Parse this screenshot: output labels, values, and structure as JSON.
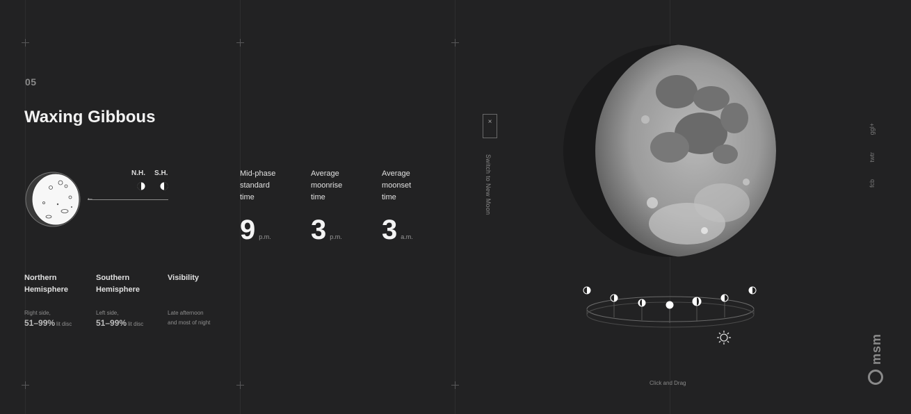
{
  "phase": {
    "number": "05",
    "title": "Waxing Gibbous"
  },
  "hemispheres": {
    "nh_label": "N.H.",
    "sh_label": "S.H."
  },
  "times": [
    {
      "label_lines": [
        "Mid-phase",
        "standard",
        "time"
      ],
      "value": "9",
      "unit": "p.m."
    },
    {
      "label_lines": [
        "Average",
        "moonrise",
        "time"
      ],
      "value": "3",
      "unit": "p.m."
    },
    {
      "label_lines": [
        "Average",
        "moonset",
        "time"
      ],
      "value": "3",
      "unit": "a.m."
    }
  ],
  "info": [
    {
      "title_lines": [
        "Northern",
        "Hemisphere"
      ],
      "desc_small": "Right side,",
      "desc_big": "51–99%",
      "desc_suffix": "lit disc"
    },
    {
      "title_lines": [
        "Southern",
        "Hemisphere"
      ],
      "desc_small": "Left side,",
      "desc_big": "51–99%",
      "desc_suffix": "lit disc"
    },
    {
      "title_lines": [
        "Visibility"
      ],
      "desc_small": "Late afternoon",
      "desc_line2": "and most of night"
    }
  ],
  "switch": {
    "close_symbol": "×",
    "label": "Switch to New Moon"
  },
  "orbit_hint": "Click and Drag",
  "social": [
    "ggl+",
    "twtr",
    "fcb"
  ],
  "logo": "msm",
  "colors": {
    "background": "#222223",
    "text": "#f2f2f2",
    "muted": "#8a8a8a"
  },
  "icons": [
    "close-icon",
    "sun-icon",
    "moon-phase-icon",
    "arrow-left-icon"
  ]
}
